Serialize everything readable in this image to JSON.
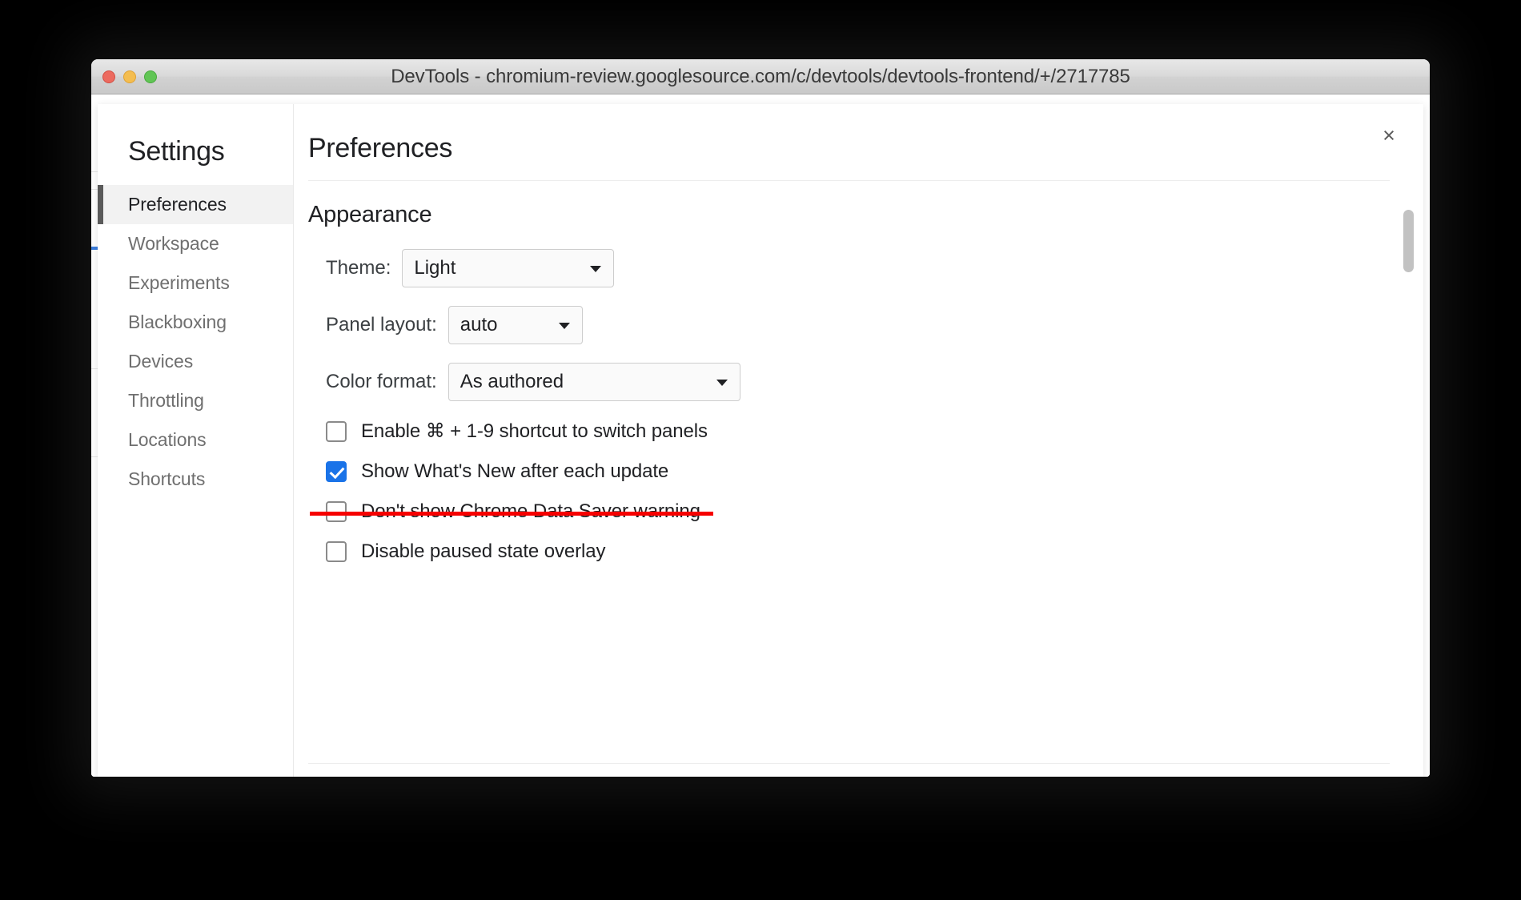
{
  "window": {
    "title": "DevTools - chromium-review.googlesource.com/c/devtools/devtools-frontend/+/2717785",
    "traffic_lights": {
      "close_label": "close",
      "minimize_label": "minimize",
      "zoom_label": "zoom"
    }
  },
  "dialog": {
    "close_icon": "×",
    "sidebar": {
      "title": "Settings",
      "items": [
        {
          "label": "Preferences",
          "selected": true
        },
        {
          "label": "Workspace",
          "selected": false
        },
        {
          "label": "Experiments",
          "selected": false
        },
        {
          "label": "Blackboxing",
          "selected": false
        },
        {
          "label": "Devices",
          "selected": false
        },
        {
          "label": "Throttling",
          "selected": false
        },
        {
          "label": "Locations",
          "selected": false
        },
        {
          "label": "Shortcuts",
          "selected": false
        }
      ]
    },
    "content": {
      "title": "Preferences",
      "section": {
        "heading": "Appearance",
        "selects": [
          {
            "label": "Theme:",
            "value": "Light"
          },
          {
            "label": "Panel layout:",
            "value": "auto"
          },
          {
            "label": "Color format:",
            "value": "As authored"
          }
        ],
        "checkboxes": [
          {
            "label": "Enable ⌘ + 1-9 shortcut to switch panels",
            "checked": false,
            "struck": false
          },
          {
            "label": "Show What's New after each update",
            "checked": true,
            "struck": false
          },
          {
            "label": "Don't show Chrome Data Saver warning",
            "checked": false,
            "struck": true
          },
          {
            "label": "Disable paused state overlay",
            "checked": false,
            "struck": false
          }
        ]
      }
    }
  },
  "colors": {
    "accent": "#1a73e8",
    "strikethrough": "#f60000",
    "selected_bg": "#f2f2f2",
    "selected_bar": "#5a5a5a"
  }
}
